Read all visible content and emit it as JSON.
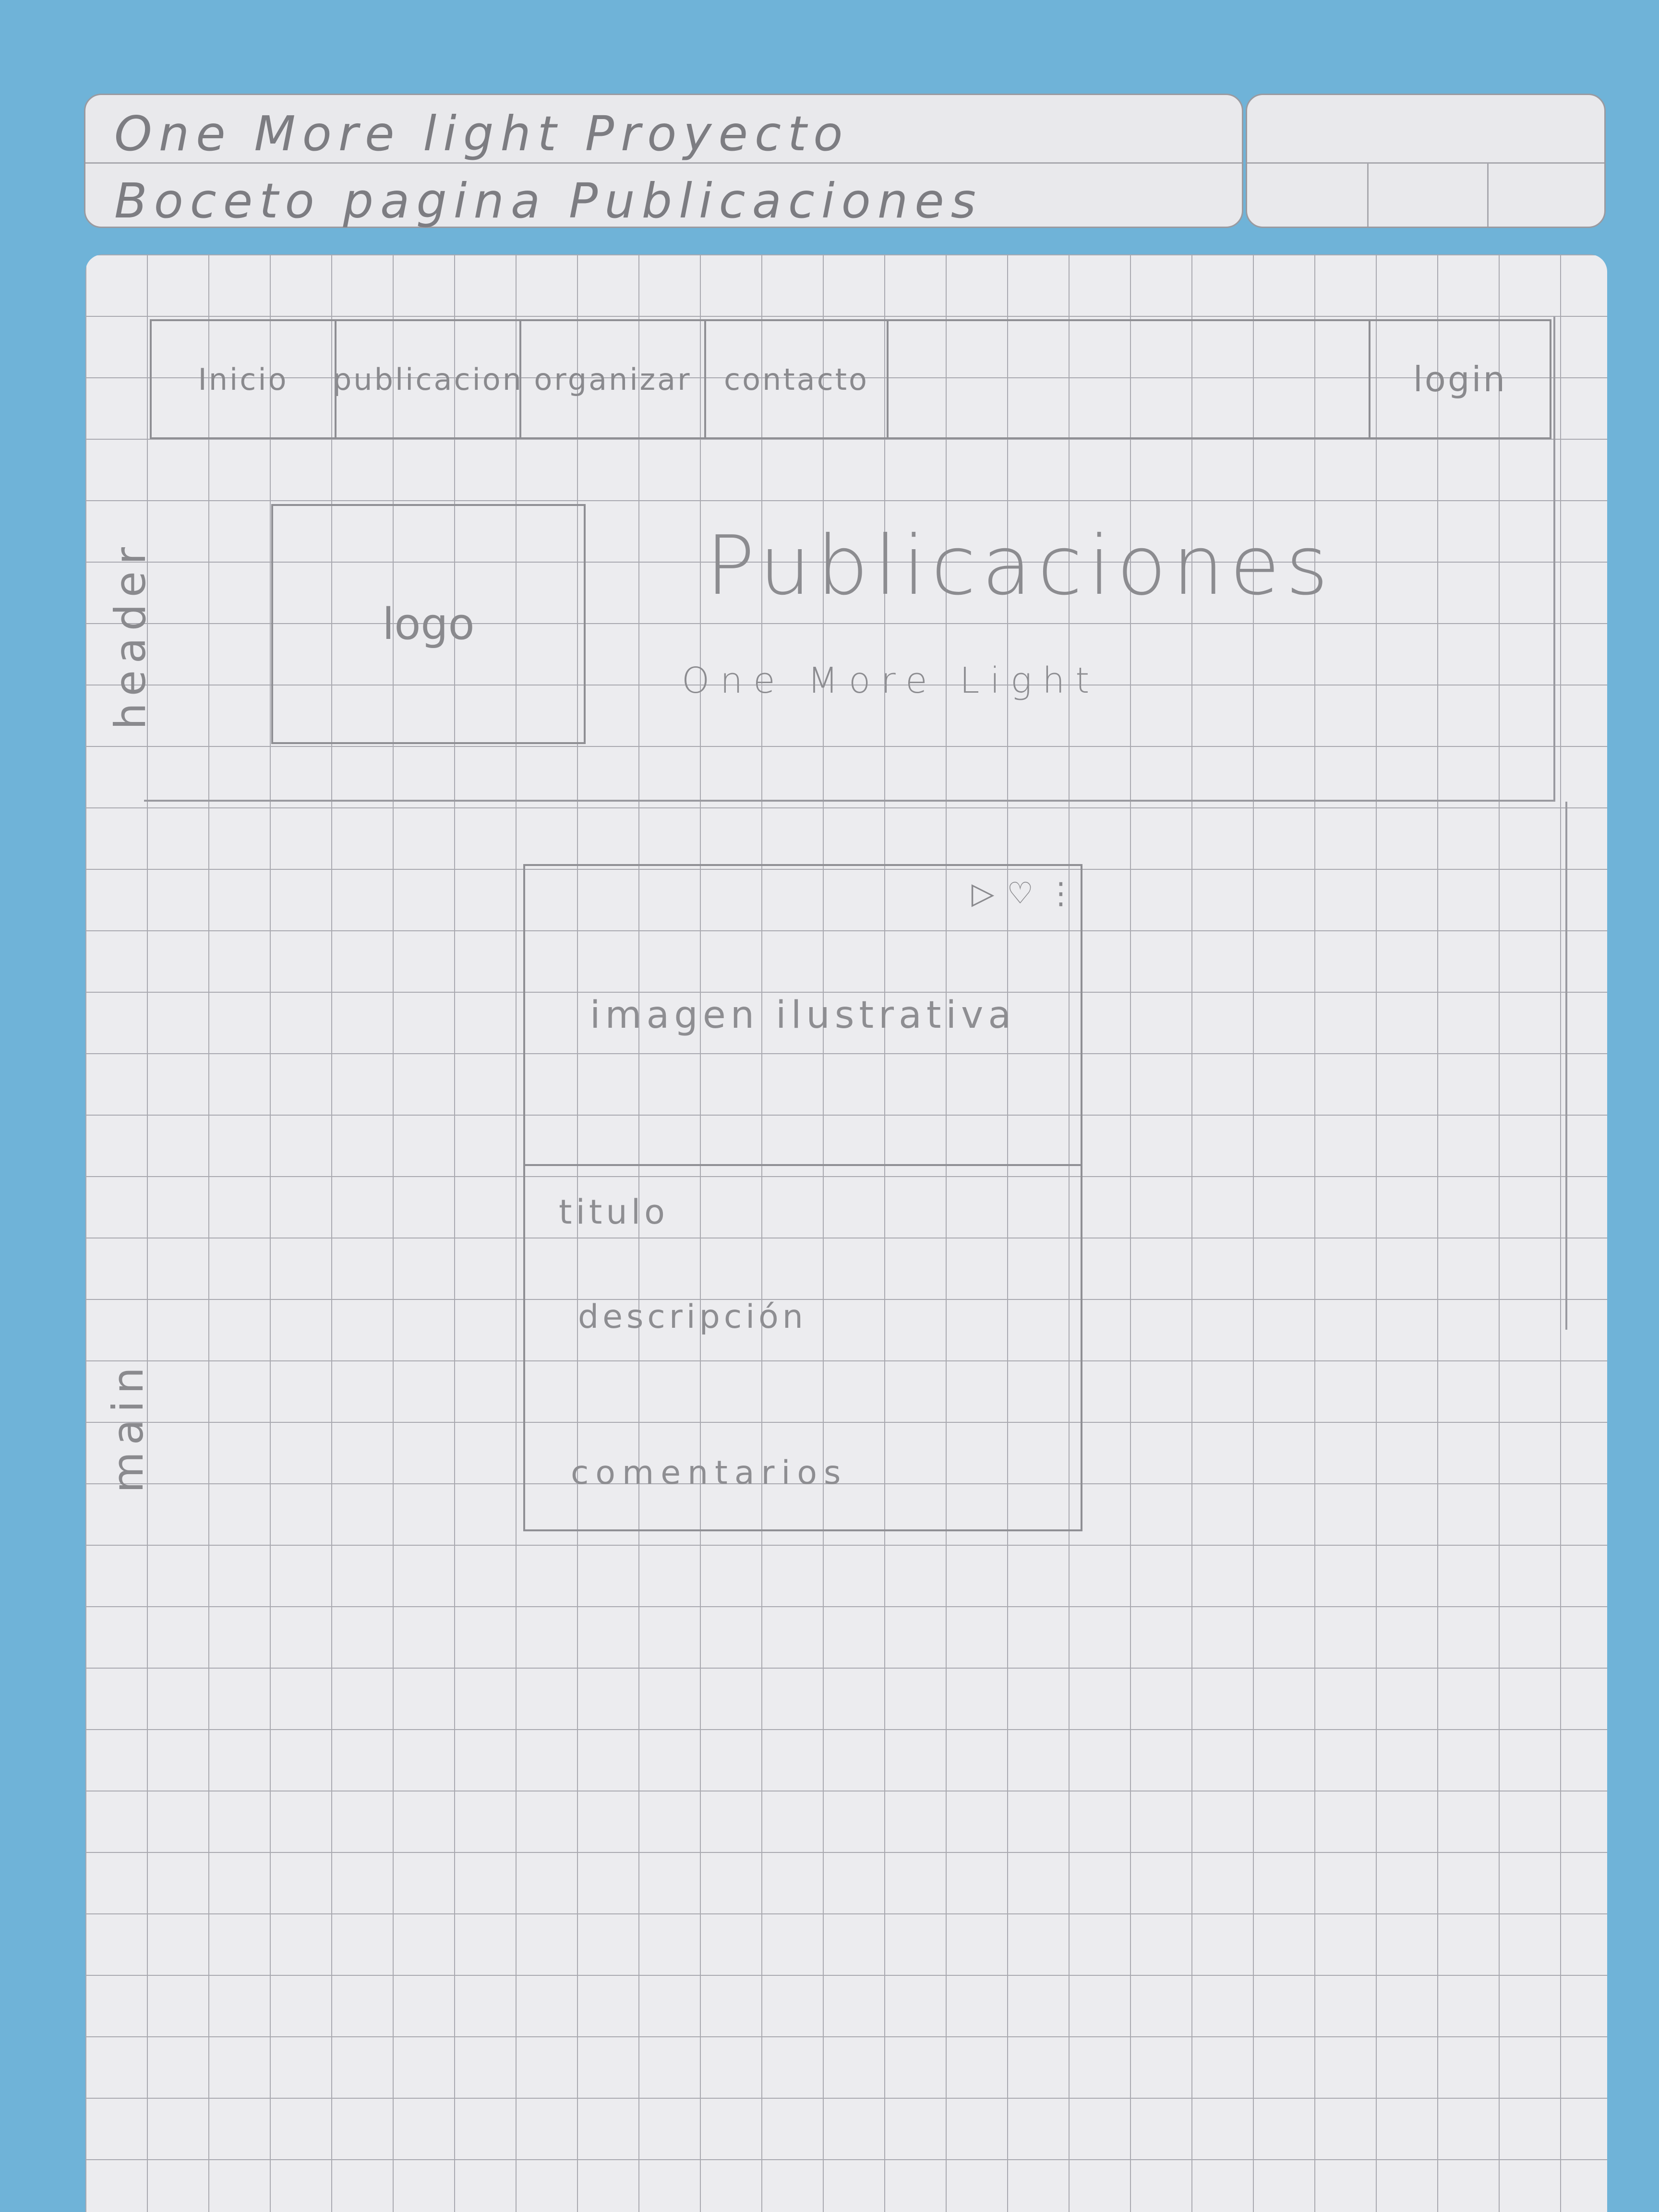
{
  "sheet_header": {
    "line1": "One More light Proyecto",
    "line2": "Boceto pagina Publicaciones"
  },
  "nav": {
    "items": [
      "Inicio",
      "publicacion",
      "organizar",
      "contacto"
    ],
    "login": "login"
  },
  "regions": {
    "header_label": "header",
    "main_label": "main"
  },
  "hero": {
    "logo_label": "logo",
    "title": "Publicaciones",
    "subtitle": "One More Light"
  },
  "post": {
    "image_label": "imagen ilustrativa",
    "title_label": "titulo",
    "description_label": "descripción",
    "comments_label": "comentarios",
    "actions": {
      "share": "▷",
      "like": "♡",
      "more": "⋮"
    }
  }
}
